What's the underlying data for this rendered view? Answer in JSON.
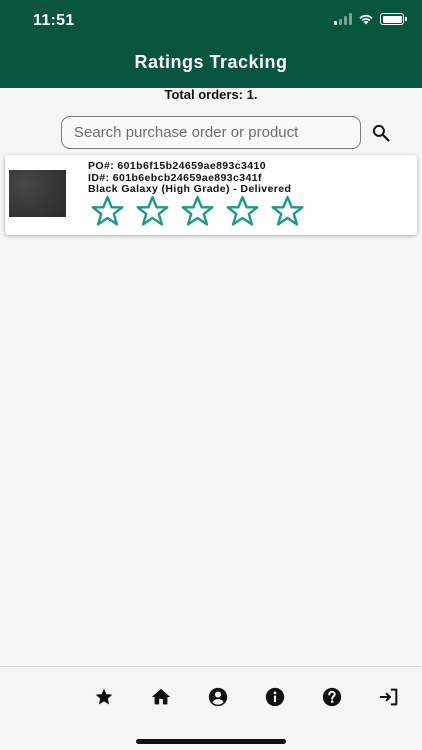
{
  "status_bar": {
    "time": "11:51"
  },
  "header": {
    "title": "Ratings Tracking"
  },
  "summary": {
    "total_orders": "Total orders: 1."
  },
  "search": {
    "placeholder": "Search purchase order or product",
    "value": ""
  },
  "orders": [
    {
      "po": "PO#: 601b6f15b24659ae893c3410",
      "id": "ID#: 601b6ebcb24659ae893c341f",
      "product": "Black Galaxy (High Grade) - Delivered",
      "rating": 0,
      "max_rating": 5
    }
  ],
  "bottom_nav": {
    "items": [
      "star-icon",
      "home-icon",
      "account-icon",
      "info-icon",
      "help-icon",
      "logout-icon"
    ]
  },
  "colors": {
    "header_bg": "#07543f",
    "star_outline": "#1a9a8a",
    "background": "#f6f6f6"
  }
}
